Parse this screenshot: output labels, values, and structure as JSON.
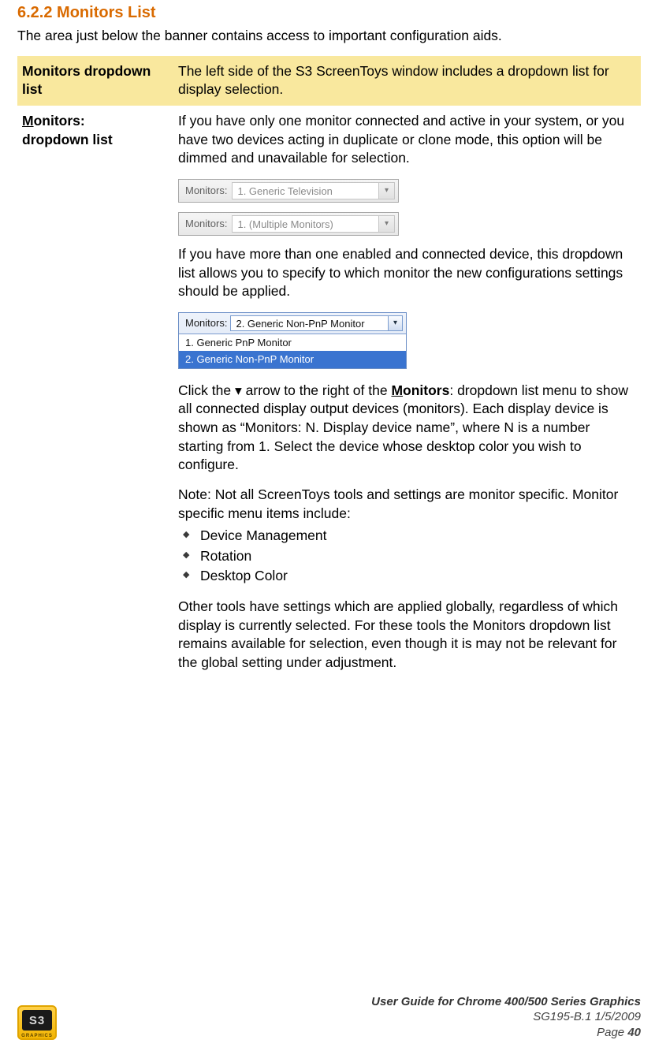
{
  "heading": {
    "number": "6.2.2",
    "title": "Monitors List"
  },
  "intro": "The area just below the banner contains access to important configuration aids.",
  "table": {
    "highlight": {
      "label": "Monitors dropdown list",
      "desc": "The left side of the S3 ScreenToys window includes a dropdown list for display selection."
    },
    "row": {
      "label_prefix_u": "M",
      "label_rest": "onitors:",
      "label_line2": "dropdown list",
      "para1": "If you have only one monitor connected and active in your system, or you have two devices acting in duplicate or clone mode, this option will be dimmed and unavailable for selection.",
      "dd1": {
        "label": "Monitors:",
        "value": "1. Generic Television"
      },
      "dd2": {
        "label": "Monitors:",
        "value": "1. (Multiple Monitors)"
      },
      "para2": "If you have more than one enabled and connected device, this dropdown list allows you to specify to which monitor the new configurations settings should be applied.",
      "dd_open": {
        "label": "Monitors:",
        "value": "2. Generic Non-PnP Monitor",
        "options": [
          "1. Generic PnP Monitor",
          "2. Generic Non-PnP Monitor"
        ],
        "selected_index": 1
      },
      "para3_a": "Click the ",
      "para3_arrow": "▾",
      "para3_b": " arrow to the right of the ",
      "para3_under_u": "M",
      "para3_under_rest": "onitors",
      "para3_c": ": dropdown list menu to show all connected display output devices (monitors). Each display device is shown as “Monitors: N. Display device name”, where N is a number starting from 1. Select the device whose desktop color you wish to configure.",
      "note": "Note: Not all ScreenToys tools and settings are monitor specific. Monitor specific menu items include:",
      "bullets": [
        "Device Management",
        "Rotation",
        "Desktop Color"
      ],
      "para4": "Other tools have settings which are applied globally, regardless of which display is currently selected. For these tools the Monitors dropdown list remains available for selection, even though it is may not be relevant for the global setting under adjustment."
    }
  },
  "footer": {
    "logo_text": "S3",
    "logo_sub": "GRAPHICS",
    "title": "User Guide for Chrome 400/500 Series Graphics",
    "sub": "SG195-B.1   1/5/2009",
    "page_label": "Page ",
    "page_num": "40"
  }
}
